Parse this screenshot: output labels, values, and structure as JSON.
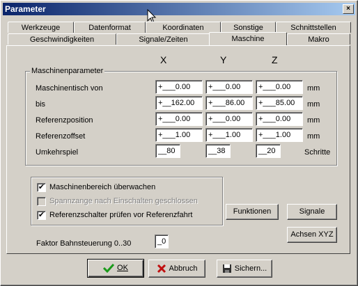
{
  "window": {
    "title": "Parameter",
    "close_label": "×"
  },
  "tabs_row1": [
    "Werkzeuge",
    "Datenformat",
    "Koordinaten",
    "Sonstige",
    "Schnittstellen"
  ],
  "tabs_row2": [
    "Geschwindigkeiten",
    "Signale/Zeiten",
    "Maschine",
    "Makro"
  ],
  "active_tab": "Maschine",
  "axes": {
    "x": "X",
    "y": "Y",
    "z": "Z"
  },
  "group": {
    "title": "Maschinenparameter",
    "rows": [
      {
        "label": "Maschinentisch von",
        "x": "+___0.00",
        "y": "+___0.00",
        "z": "+___0.00",
        "unit": "mm"
      },
      {
        "label": "bis",
        "x": "+__162.00",
        "y": "+___86.00",
        "z": "+___85.00",
        "unit": "mm"
      },
      {
        "label": "Referenzposition",
        "x": "+___0.00",
        "y": "+___0.00",
        "z": "+___0.00",
        "unit": "mm"
      },
      {
        "label": "Referenzoffset",
        "x": "+___1.00",
        "y": "+___1.00",
        "z": "+___1.00",
        "unit": "mm"
      },
      {
        "label": "Umkehrspiel",
        "x": "__80",
        "y": "__38",
        "z": "__20",
        "unit": "Schritte"
      }
    ]
  },
  "checks": [
    {
      "label": "Maschinenbereich überwachen",
      "checked": "✔",
      "enabled": true
    },
    {
      "label": "Spannzange nach Einschalten geschlossen",
      "checked": "",
      "enabled": false
    },
    {
      "label": "Referenzschalter prüfen vor Referenzfahrt",
      "checked": "✔",
      "enabled": true
    }
  ],
  "side_buttons": {
    "funktionen": "Funktionen",
    "signale": "Signale",
    "achsen": "Achsen XYZ"
  },
  "faktor": {
    "label": "Faktor Bahnsteuerung 0..30",
    "value": "_0"
  },
  "footer": {
    "ok": "OK",
    "abbruch": "Abbruch",
    "sichern": "Sichern..."
  },
  "colors": {
    "title_start": "#0a246a",
    "title_end": "#a6caf0",
    "face": "#d4d0c8",
    "ok_green": "#1a9a1a",
    "cancel_red": "#c01010"
  }
}
